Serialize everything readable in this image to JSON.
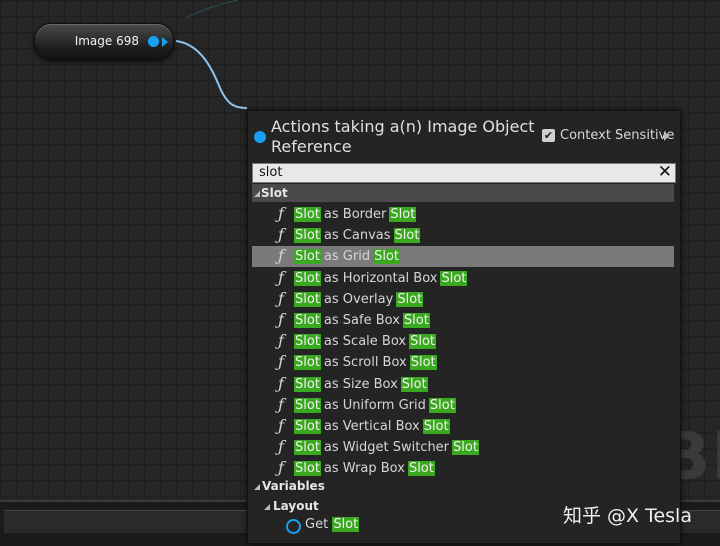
{
  "node": {
    "label": "Image 698"
  },
  "menu": {
    "title": "Actions taking a(n) Image Object Reference",
    "context_sensitive_label": "Context Sensitive",
    "search_value": "slot",
    "slot_category": "Slot",
    "highlight": "Slot",
    "function_items": [
      "as Border",
      "as Canvas",
      "as Grid",
      "as Horizontal Box",
      "as Overlay",
      "as Safe Box",
      "as Scale Box",
      "as Scroll Box",
      "as Size Box",
      "as Uniform Grid",
      "as Vertical Box",
      "as Widget Switcher",
      "as Wrap Box"
    ],
    "selected_index": 2,
    "variables_category": "Variables",
    "layout_category": "Layout",
    "get_prefix": "Get"
  },
  "background_text": "BL",
  "watermark": "知乎 @X Tesla",
  "colors": {
    "pin": "#1aa0f2",
    "highlight": "#3aa91f",
    "selected_row": "#7a7a7a"
  }
}
